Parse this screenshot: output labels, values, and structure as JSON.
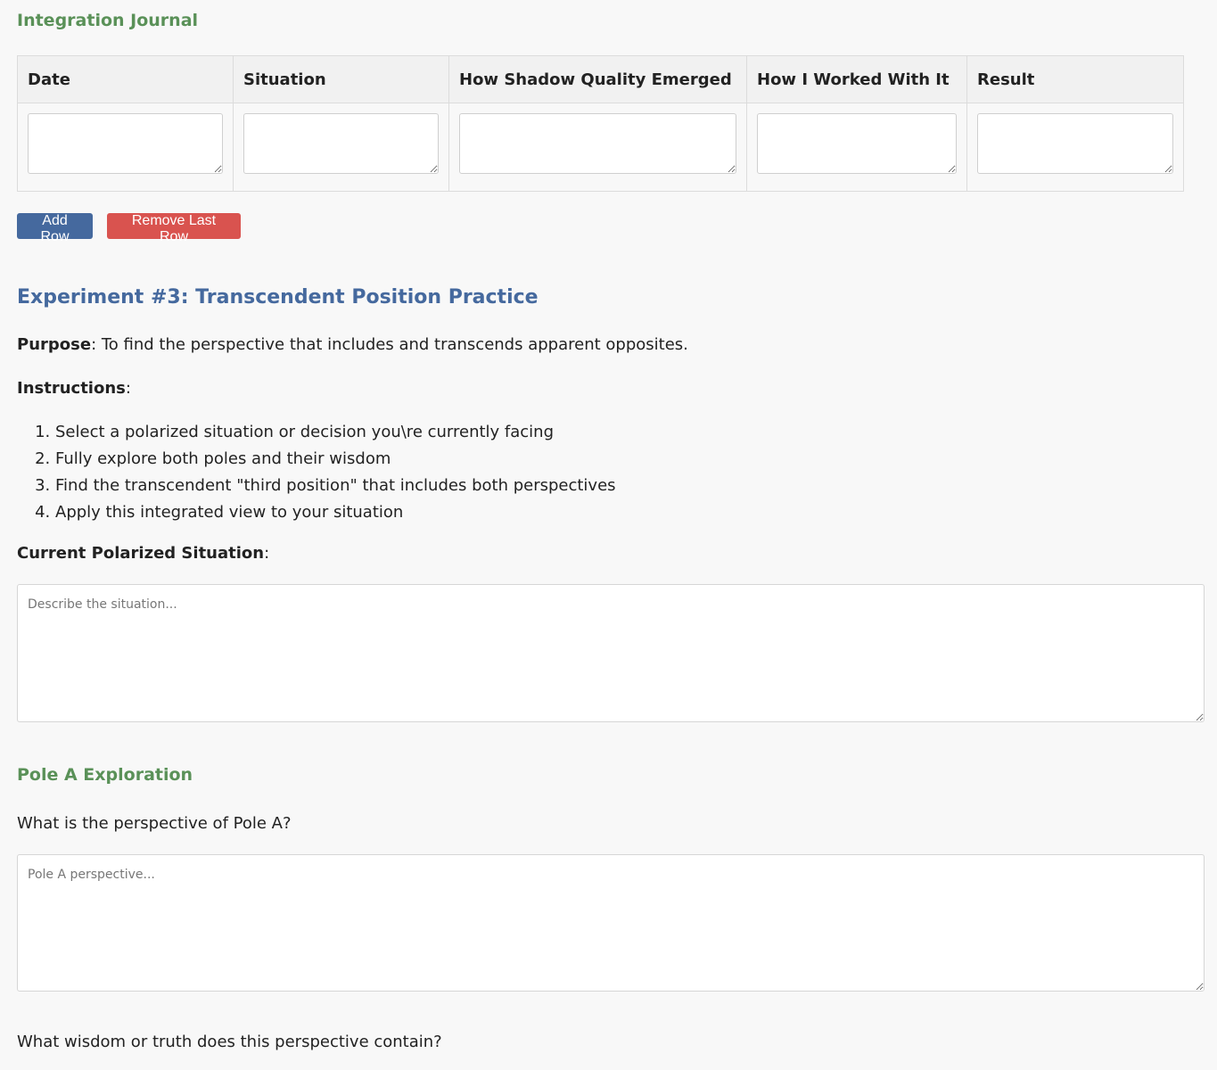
{
  "journal": {
    "title": "Integration Journal",
    "columns": [
      "Date",
      "Situation",
      "How Shadow Quality Emerged",
      "How I Worked With It",
      "Result"
    ],
    "add_row_label": "Add Row",
    "remove_row_label": "Remove Last Row"
  },
  "experiment": {
    "title": "Experiment #3: Transcendent Position Practice",
    "purpose_label": "Purpose",
    "purpose_text": ": To find the perspective that includes and transcends apparent opposites.",
    "instructions_label": "Instructions",
    "instructions_suffix": ":",
    "steps": [
      "Select a polarized situation or decision you\\re currently facing",
      "Fully explore both poles and their wisdom",
      "Find the transcendent \"third position\" that includes both perspectives",
      "Apply this integrated view to your situation"
    ],
    "situation_label": "Current Polarized Situation",
    "situation_suffix": ":",
    "situation_placeholder": "Describe the situation...",
    "pole_a": {
      "title": "Pole A Exploration",
      "question": "What is the perspective of Pole A?",
      "placeholder": "Pole A perspective...",
      "wisdom_question": "What wisdom or truth does this perspective contain?"
    }
  },
  "colors": {
    "green_heading": "#5a9158",
    "blue_heading": "#45699e",
    "add_button": "#45699e",
    "remove_button": "#d9534f"
  }
}
